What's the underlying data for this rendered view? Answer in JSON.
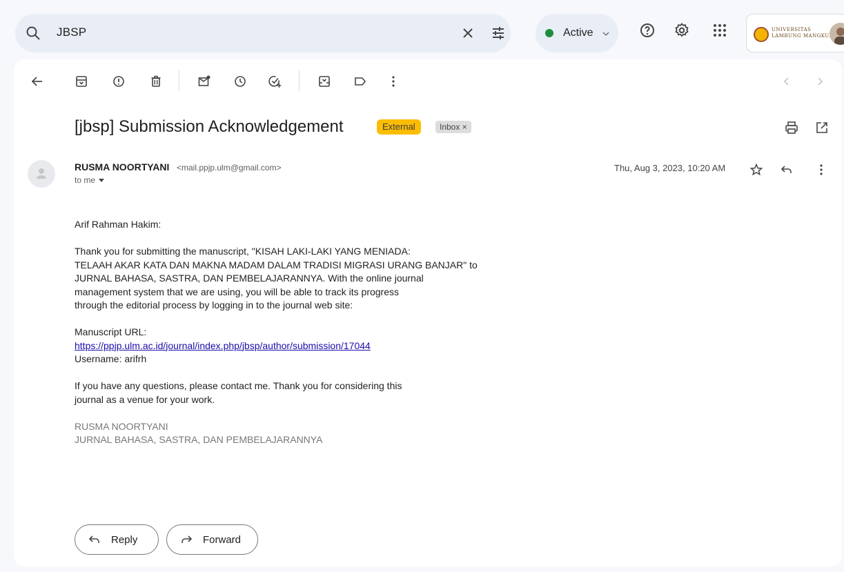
{
  "search": {
    "query": "JBSP"
  },
  "status": {
    "label": "Active",
    "color": "#1e8e3e"
  },
  "account": {
    "org_line1": "UNIVERSITAS",
    "org_line2": "LAMBUNG MANGKURAT"
  },
  "toolbar": {
    "icons": [
      "back-arrow-icon",
      "archive-icon",
      "report-spam-icon",
      "delete-icon",
      "mark-unread-icon",
      "snooze-icon",
      "add-task-icon",
      "move-to-icon",
      "label-icon",
      "more-vert-icon",
      "prev-icon",
      "next-icon"
    ]
  },
  "email": {
    "subject": "[jbsp] Submission Acknowledgement",
    "labels": {
      "external": "External",
      "inbox": "Inbox ×"
    },
    "sender_name": "RUSMA NOORTYANI",
    "sender_email": "<mail.ppjp.ulm@gmail.com>",
    "to": "to me",
    "date": "Thu, Aug 3, 2023, 10:20 AM",
    "greeting": "Arif Rahman Hakim:",
    "para1_line1": "Thank you for submitting the manuscript, \"KISAH LAKI-LAKI YANG MENIADA:",
    "para1_line2": "TELAAH AKAR KATA DAN MAKNA MADAM DALAM TRADISI MIGRASI URANG BANJAR\" to",
    "para1_line3": "JURNAL BAHASA, SASTRA, DAN PEMBELAJARANNYA. With the online journal",
    "para1_line4": "management system that we are using, you will be able to track its progress",
    "para1_line5": "through the editorial process by logging in to the journal web site:",
    "url_label": "Manuscript URL:",
    "url": "https://ppjp.ulm.ac.id/journal/index.php/jbsp/author/submission/17044",
    "username": "Username: arifrh",
    "para2_line1": "If you have any questions, please contact me. Thank you for considering this",
    "para2_line2": "journal as a venue for your work.",
    "sig_name": "RUSMA NOORTYANI",
    "sig_journal": "JURNAL BAHASA, SASTRA, DAN PEMBELAJARANNYA"
  },
  "actions": {
    "reply": "Reply",
    "forward": "Forward"
  }
}
